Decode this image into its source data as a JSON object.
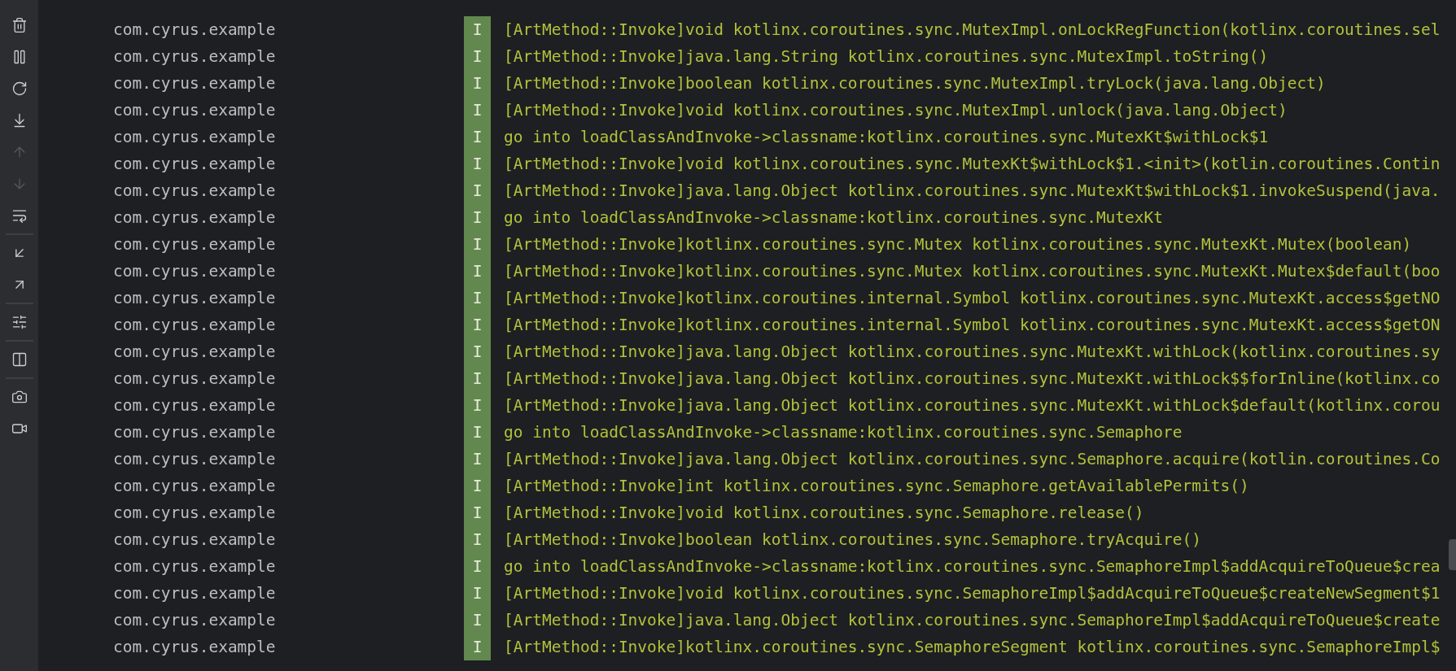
{
  "toolbar": [
    {
      "kind": "delete",
      "disabled": false
    },
    {
      "kind": "pause",
      "disabled": false
    },
    {
      "kind": "restart",
      "disabled": false
    },
    {
      "kind": "scroll-end",
      "disabled": false
    },
    {
      "kind": "up",
      "disabled": true
    },
    {
      "kind": "down",
      "disabled": true
    },
    {
      "kind": "wrap",
      "disabled": false
    },
    {
      "kind": "divider"
    },
    {
      "kind": "import",
      "disabled": false
    },
    {
      "kind": "export",
      "disabled": false
    },
    {
      "kind": "divider"
    },
    {
      "kind": "filter",
      "disabled": false
    },
    {
      "kind": "divider"
    },
    {
      "kind": "split",
      "disabled": false
    },
    {
      "kind": "divider"
    },
    {
      "kind": "screenshot",
      "disabled": false
    },
    {
      "kind": "record",
      "disabled": false
    }
  ],
  "log": {
    "rows": [
      {
        "package": "com.cyrus.example",
        "level": "I",
        "message": "[ArtMethod::Invoke]void kotlinx.coroutines.sync.MutexImpl.onLockRegFunction(kotlinx.coroutines.sel"
      },
      {
        "package": "com.cyrus.example",
        "level": "I",
        "message": "[ArtMethod::Invoke]java.lang.String kotlinx.coroutines.sync.MutexImpl.toString()"
      },
      {
        "package": "com.cyrus.example",
        "level": "I",
        "message": "[ArtMethod::Invoke]boolean kotlinx.coroutines.sync.MutexImpl.tryLock(java.lang.Object)"
      },
      {
        "package": "com.cyrus.example",
        "level": "I",
        "message": "[ArtMethod::Invoke]void kotlinx.coroutines.sync.MutexImpl.unlock(java.lang.Object)"
      },
      {
        "package": "com.cyrus.example",
        "level": "I",
        "message": "go into loadClassAndInvoke->classname:kotlinx.coroutines.sync.MutexKt$withLock$1"
      },
      {
        "package": "com.cyrus.example",
        "level": "I",
        "message": "[ArtMethod::Invoke]void kotlinx.coroutines.sync.MutexKt$withLock$1.<init>(kotlin.coroutines.Contin"
      },
      {
        "package": "com.cyrus.example",
        "level": "I",
        "message": "[ArtMethod::Invoke]java.lang.Object kotlinx.coroutines.sync.MutexKt$withLock$1.invokeSuspend(java."
      },
      {
        "package": "com.cyrus.example",
        "level": "I",
        "message": "go into loadClassAndInvoke->classname:kotlinx.coroutines.sync.MutexKt"
      },
      {
        "package": "com.cyrus.example",
        "level": "I",
        "message": "[ArtMethod::Invoke]kotlinx.coroutines.sync.Mutex kotlinx.coroutines.sync.MutexKt.Mutex(boolean)"
      },
      {
        "package": "com.cyrus.example",
        "level": "I",
        "message": "[ArtMethod::Invoke]kotlinx.coroutines.sync.Mutex kotlinx.coroutines.sync.MutexKt.Mutex$default(boo"
      },
      {
        "package": "com.cyrus.example",
        "level": "I",
        "message": "[ArtMethod::Invoke]kotlinx.coroutines.internal.Symbol kotlinx.coroutines.sync.MutexKt.access$getNO"
      },
      {
        "package": "com.cyrus.example",
        "level": "I",
        "message": "[ArtMethod::Invoke]kotlinx.coroutines.internal.Symbol kotlinx.coroutines.sync.MutexKt.access$getON"
      },
      {
        "package": "com.cyrus.example",
        "level": "I",
        "message": "[ArtMethod::Invoke]java.lang.Object kotlinx.coroutines.sync.MutexKt.withLock(kotlinx.coroutines.sy"
      },
      {
        "package": "com.cyrus.example",
        "level": "I",
        "message": "[ArtMethod::Invoke]java.lang.Object kotlinx.coroutines.sync.MutexKt.withLock$$forInline(kotlinx.co"
      },
      {
        "package": "com.cyrus.example",
        "level": "I",
        "message": "[ArtMethod::Invoke]java.lang.Object kotlinx.coroutines.sync.MutexKt.withLock$default(kotlinx.corou"
      },
      {
        "package": "com.cyrus.example",
        "level": "I",
        "message": "go into loadClassAndInvoke->classname:kotlinx.coroutines.sync.Semaphore"
      },
      {
        "package": "com.cyrus.example",
        "level": "I",
        "message": "[ArtMethod::Invoke]java.lang.Object kotlinx.coroutines.sync.Semaphore.acquire(kotlin.coroutines.Co"
      },
      {
        "package": "com.cyrus.example",
        "level": "I",
        "message": "[ArtMethod::Invoke]int kotlinx.coroutines.sync.Semaphore.getAvailablePermits()"
      },
      {
        "package": "com.cyrus.example",
        "level": "I",
        "message": "[ArtMethod::Invoke]void kotlinx.coroutines.sync.Semaphore.release()"
      },
      {
        "package": "com.cyrus.example",
        "level": "I",
        "message": "[ArtMethod::Invoke]boolean kotlinx.coroutines.sync.Semaphore.tryAcquire()"
      },
      {
        "package": "com.cyrus.example",
        "level": "I",
        "message": "go into loadClassAndInvoke->classname:kotlinx.coroutines.sync.SemaphoreImpl$addAcquireToQueue$crea"
      },
      {
        "package": "com.cyrus.example",
        "level": "I",
        "message": "[ArtMethod::Invoke]void kotlinx.coroutines.sync.SemaphoreImpl$addAcquireToQueue$createNewSegment$1"
      },
      {
        "package": "com.cyrus.example",
        "level": "I",
        "message": "[ArtMethod::Invoke]java.lang.Object kotlinx.coroutines.sync.SemaphoreImpl$addAcquireToQueue$create"
      },
      {
        "package": "com.cyrus.example",
        "level": "I",
        "message": "[ArtMethod::Invoke]kotlinx.coroutines.sync.SemaphoreSegment kotlinx.coroutines.sync.SemaphoreImpl$"
      }
    ]
  }
}
